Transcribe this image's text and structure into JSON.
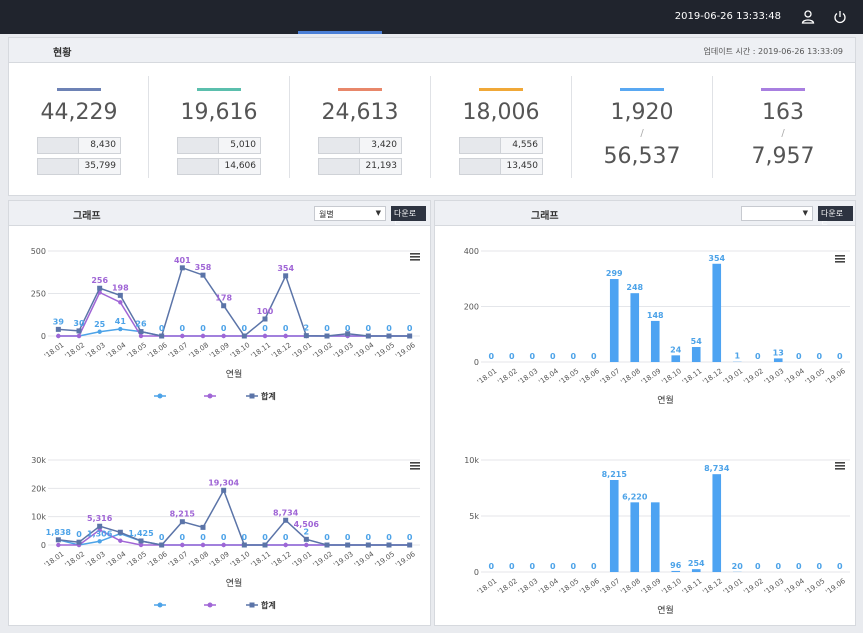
{
  "header": {
    "datetime": "2019-06-26 13:33:48",
    "user_icon": "user-icon",
    "power_icon": "power-icon"
  },
  "status": {
    "title": "현황",
    "update_label": "업데이트 시간 : 2019-06-26 13:33:09",
    "cards": [
      {
        "color": "#6d82b5",
        "main": "44,229",
        "sub1": "8,430",
        "sub2": "35,799"
      },
      {
        "color": "#5bbfad",
        "main": "19,616",
        "sub1": "5,010",
        "sub2": "14,606"
      },
      {
        "color": "#e8876a",
        "main": "24,613",
        "sub1": "3,420",
        "sub2": "21,193"
      },
      {
        "color": "#f0a838",
        "main": "18,006",
        "sub1": "4,556",
        "sub2": "13,450"
      },
      {
        "color": "#59a8f2",
        "main": "1,920",
        "slash": "/",
        "second": "56,537"
      },
      {
        "color": "#a87fe0",
        "main": "163",
        "slash": "/",
        "second": "7,957"
      }
    ]
  },
  "left_panel": {
    "title": "그래프",
    "select_value": "월별",
    "download_label": "다운로드",
    "menu_icon": "hamburger-menu-icon"
  },
  "right_panel": {
    "title": "그래프",
    "select_value": "",
    "download_label": "다운로드",
    "menu_icon": "hamburger-menu-icon"
  },
  "chart_data": [
    {
      "type": "line",
      "categories": [
        "'18.01",
        "'18.02",
        "'18.03",
        "'18.04",
        "'18.05",
        "'18.06",
        "'18.07",
        "'18.08",
        "'18.09",
        "'18.10",
        "'18.11",
        "'18.12",
        "'19.01",
        "'19.02",
        "'19.03",
        "'19.04",
        "'19.05",
        "'19.06"
      ],
      "xlabel": "연월",
      "ylim": [
        0,
        500
      ],
      "yticks": [
        "0",
        "250",
        "500"
      ],
      "legend": [
        "",
        "",
        "합계"
      ],
      "series": [
        {
          "color": "#4da3e8",
          "values": [
            0,
            0,
            25,
            41,
            26,
            0,
            0,
            0,
            0,
            0,
            0,
            0,
            0,
            0,
            0,
            0,
            0,
            0
          ]
        },
        {
          "color": "#a066d6",
          "values": [
            0,
            0,
            256,
            198,
            0,
            0,
            0,
            0,
            0,
            0,
            0,
            0,
            0,
            0,
            0,
            0,
            0,
            0
          ]
        },
        {
          "name": "합계",
          "color": "#5b74a8",
          "values": [
            39,
            30,
            281,
            239,
            26,
            0,
            401,
            358,
            178,
            0,
            100,
            354,
            2,
            0,
            13,
            0,
            0,
            0
          ]
        }
      ],
      "labels": [
        {
          "i": 0,
          "text": "39",
          "color": "#4da3e8",
          "v": 39
        },
        {
          "i": 1,
          "text": "30",
          "color": "#4da3e8",
          "v": 30
        },
        {
          "i": 2,
          "text": "256",
          "color": "#a066d6",
          "v": 281
        },
        {
          "i": 2,
          "text": "25",
          "color": "#4da3e8",
          "v": 25
        },
        {
          "i": 3,
          "text": "198",
          "color": "#a066d6",
          "v": 239
        },
        {
          "i": 3,
          "text": "41",
          "color": "#4da3e8",
          "v": 41
        },
        {
          "i": 4,
          "text": "26",
          "color": "#4da3e8",
          "v": 26
        },
        {
          "i": 5,
          "text": "0",
          "color": "#4da3e8",
          "v": 0
        },
        {
          "i": 6,
          "text": "401",
          "color": "#a066d6",
          "v": 401
        },
        {
          "i": 6,
          "text": "0",
          "color": "#4da3e8",
          "v": 0
        },
        {
          "i": 7,
          "text": "358",
          "color": "#a066d6",
          "v": 358
        },
        {
          "i": 7,
          "text": "0",
          "color": "#4da3e8",
          "v": 0
        },
        {
          "i": 8,
          "text": "178",
          "color": "#a066d6",
          "v": 178
        },
        {
          "i": 8,
          "text": "0",
          "color": "#4da3e8",
          "v": 0
        },
        {
          "i": 9,
          "text": "0",
          "color": "#4da3e8",
          "v": 0
        },
        {
          "i": 10,
          "text": "100",
          "color": "#a066d6",
          "v": 100
        },
        {
          "i": 10,
          "text": "0",
          "color": "#4da3e8",
          "v": 0
        },
        {
          "i": 11,
          "text": "354",
          "color": "#a066d6",
          "v": 354
        },
        {
          "i": 11,
          "text": "0",
          "color": "#4da3e8",
          "v": 0
        },
        {
          "i": 12,
          "text": "2",
          "color": "#4da3e8",
          "v": 2
        },
        {
          "i": 13,
          "text": "0",
          "color": "#4da3e8",
          "v": 0
        },
        {
          "i": 14,
          "text": "0",
          "color": "#4da3e8",
          "v": 0
        },
        {
          "i": 15,
          "text": "0",
          "color": "#4da3e8",
          "v": 0
        },
        {
          "i": 16,
          "text": "0",
          "color": "#4da3e8",
          "v": 0
        },
        {
          "i": 17,
          "text": "0",
          "color": "#4da3e8",
          "v": 0
        }
      ]
    },
    {
      "type": "bar",
      "categories": [
        "'18.01",
        "'18.02",
        "'18.03",
        "'18.04",
        "'18.05",
        "'18.06",
        "'18.07",
        "'18.08",
        "'18.09",
        "'18.10",
        "'18.11",
        "'18.12",
        "'19.01",
        "'19.02",
        "'19.03",
        "'19.04",
        "'19.05",
        "'19.06"
      ],
      "xlabel": "연월",
      "ylim": [
        0,
        400
      ],
      "yticks": [
        "0",
        "200",
        "400"
      ],
      "color": "#4da3f2",
      "values": [
        0,
        0,
        0,
        0,
        0,
        0,
        299,
        248,
        148,
        24,
        54,
        354,
        1,
        0,
        13,
        0,
        0,
        0
      ]
    },
    {
      "type": "line",
      "categories": [
        "'18.01",
        "'18.02",
        "'18.03",
        "'18.04",
        "'18.05",
        "'18.06",
        "'18.07",
        "'18.08",
        "'18.09",
        "'18.10",
        "'18.11",
        "'18.12",
        "'19.01",
        "'19.02",
        "'19.03",
        "'19.04",
        "'19.05",
        "'19.06"
      ],
      "xlabel": "연월",
      "ylim": [
        0,
        30000
      ],
      "yticks": [
        "0",
        "10k",
        "20k",
        "30k"
      ],
      "legend": [
        "",
        "",
        "합계"
      ],
      "series": [
        {
          "color": "#4da3e8",
          "values": [
            1838,
            0,
            1306,
            4000,
            1425,
            0,
            0,
            0,
            0,
            0,
            0,
            0,
            0,
            0,
            0,
            0,
            0,
            0
          ]
        },
        {
          "color": "#a066d6",
          "values": [
            0,
            0,
            5316,
            1500,
            0,
            0,
            0,
            0,
            0,
            0,
            0,
            0,
            0,
            0,
            0,
            0,
            0,
            0
          ]
        },
        {
          "name": "합계",
          "color": "#5b74a8",
          "values": [
            1838,
            1000,
            6622,
            4500,
            1425,
            0,
            8215,
            6220,
            19304,
            0,
            0,
            8734,
            2000,
            0,
            0,
            0,
            0,
            0
          ]
        }
      ],
      "labels": [
        {
          "i": 0,
          "text": "1,838",
          "color": "#4da3e8",
          "v": 1838
        },
        {
          "i": 1,
          "text": "0",
          "color": "#4da3e8",
          "v": 1000
        },
        {
          "i": 2,
          "text": "5,316",
          "color": "#a066d6",
          "v": 6622
        },
        {
          "i": 2,
          "text": "1,306",
          "color": "#4da3e8",
          "v": 1306
        },
        {
          "i": 4,
          "text": "1,425",
          "color": "#4da3e8",
          "v": 1425
        },
        {
          "i": 5,
          "text": "0",
          "color": "#4da3e8",
          "v": 0
        },
        {
          "i": 6,
          "text": "8,215",
          "color": "#a066d6",
          "v": 8215
        },
        {
          "i": 6,
          "text": "0",
          "color": "#4da3e8",
          "v": 0
        },
        {
          "i": 7,
          "text": "0",
          "color": "#4da3e8",
          "v": 0
        },
        {
          "i": 8,
          "text": "19,304",
          "color": "#a066d6",
          "v": 19304
        },
        {
          "i": 8,
          "text": "0",
          "color": "#4da3e8",
          "v": 0
        },
        {
          "i": 9,
          "text": "0",
          "color": "#4da3e8",
          "v": 0
        },
        {
          "i": 10,
          "text": "0",
          "color": "#4da3e8",
          "v": 0
        },
        {
          "i": 11,
          "text": "8,734",
          "color": "#a066d6",
          "v": 8734
        },
        {
          "i": 11,
          "text": "0",
          "color": "#4da3e8",
          "v": 0
        },
        {
          "i": 12,
          "text": "4,506",
          "color": "#a066d6",
          "v": 4506
        },
        {
          "i": 12,
          "text": "2",
          "color": "#4da3e8",
          "v": 2000
        },
        {
          "i": 13,
          "text": "0",
          "color": "#4da3e8",
          "v": 0
        },
        {
          "i": 14,
          "text": "0",
          "color": "#4da3e8",
          "v": 0
        },
        {
          "i": 15,
          "text": "0",
          "color": "#4da3e8",
          "v": 0
        },
        {
          "i": 16,
          "text": "0",
          "color": "#4da3e8",
          "v": 0
        },
        {
          "i": 17,
          "text": "0",
          "color": "#4da3e8",
          "v": 0
        }
      ]
    },
    {
      "type": "bar",
      "categories": [
        "'18.01",
        "'18.02",
        "'18.03",
        "'18.04",
        "'18.05",
        "'18.06",
        "'18.07",
        "'18.08",
        "'18.09",
        "'18.10",
        "'18.11",
        "'18.12",
        "'19.01",
        "'19.02",
        "'19.03",
        "'19.04",
        "'19.05",
        "'19.06"
      ],
      "xlabel": "연월",
      "ylim": [
        0,
        10000
      ],
      "yticks": [
        "0",
        "5k",
        "10k"
      ],
      "color": "#4da3f2",
      "values": [
        0,
        0,
        0,
        0,
        0,
        0,
        8215,
        6220,
        6220,
        96,
        254,
        8734,
        20,
        0,
        0,
        0,
        0,
        0
      ],
      "value_labels": [
        "0",
        "0",
        "0",
        "0",
        "0",
        "0",
        "8,215",
        "6,220",
        "",
        "96",
        "254",
        "8,734",
        "20",
        "0",
        "0",
        "0",
        "0",
        "0"
      ]
    }
  ]
}
